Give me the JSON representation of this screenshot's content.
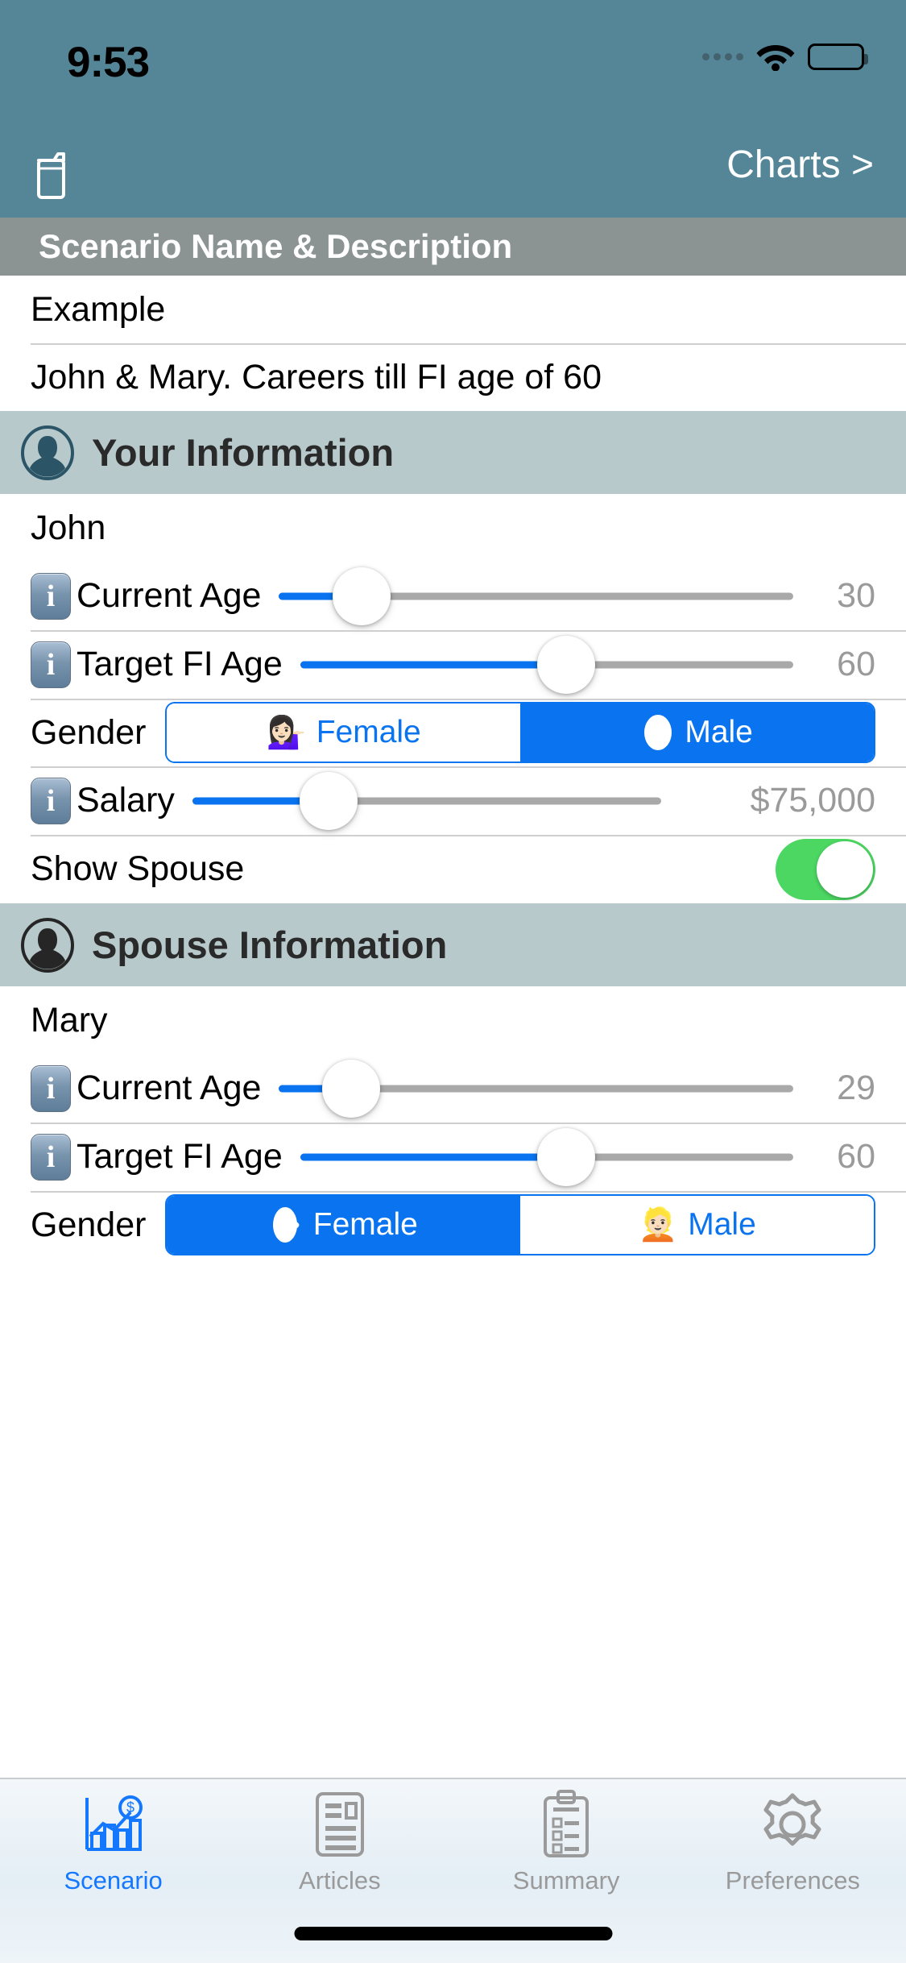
{
  "status_bar": {
    "time": "9:53",
    "signal_icon": "cellular-dots-icon",
    "wifi_icon": "wifi-icon",
    "battery_icon": "battery-full-icon"
  },
  "nav_bar": {
    "folder_icon": "folder-icon",
    "charts_label": "Charts >",
    "background_color": "#548697"
  },
  "sections": {
    "scenario": {
      "header": "Scenario Name & Description",
      "header_color": "#8b9393",
      "name": "Example",
      "description": "John & Mary. Careers till FI age of 60"
    },
    "your_info": {
      "header": "Your Information",
      "header_color": "#b7c9cb",
      "avatar_icon": "person-circle-icon",
      "name": "John",
      "current_age": {
        "label": "Current Age",
        "value": "30",
        "info_icon": "info-icon",
        "percent": 16
      },
      "target_fi_age": {
        "label": "Target FI Age",
        "value": "60",
        "info_icon": "info-icon",
        "percent": 54
      },
      "gender": {
        "label": "Gender",
        "female_label": "Female",
        "female_icon": "woman-tipping-hand-emoji",
        "male_label": "Male",
        "male_icon": "male-silhouette-icon",
        "selected": "Male"
      },
      "salary": {
        "label": "Salary",
        "value": "$75,000",
        "info_icon": "info-icon",
        "percent": 29
      },
      "show_spouse": {
        "label": "Show Spouse",
        "value": "on"
      }
    },
    "spouse_info": {
      "header": "Spouse Information",
      "header_color": "#b7c9cb",
      "avatar_icon": "person-circle-icon",
      "name": "Mary",
      "current_age": {
        "label": "Current Age",
        "value": "29",
        "info_icon": "info-icon",
        "percent": 14
      },
      "target_fi_age": {
        "label": "Target FI Age",
        "value": "60",
        "info_icon": "info-icon",
        "percent": 54
      },
      "gender": {
        "label": "Gender",
        "female_label": "Female",
        "female_icon": "female-silhouette-icon",
        "male_label": "Male",
        "male_icon": "blond-person-emoji",
        "selected": "Female"
      }
    }
  },
  "tab_bar": {
    "active_color": "#1478ff",
    "inactive_color": "#9a9a9a",
    "items": [
      {
        "label": "Scenario",
        "icon": "bar-chart-dollar-icon",
        "active": true
      },
      {
        "label": "Articles",
        "icon": "article-document-icon",
        "active": false
      },
      {
        "label": "Summary",
        "icon": "clipboard-list-icon",
        "active": false
      },
      {
        "label": "Preferences",
        "icon": "gear-icon",
        "active": false
      }
    ]
  }
}
